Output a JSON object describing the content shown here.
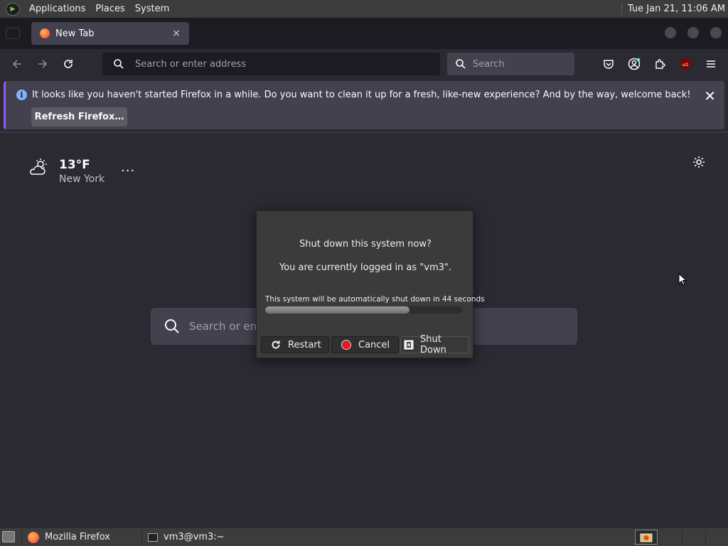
{
  "top_panel": {
    "menus": [
      "Applications",
      "Places",
      "System"
    ],
    "clock": "Tue Jan 21, 11:06 AM"
  },
  "browser": {
    "tab": {
      "title": "New Tab",
      "close": "×"
    },
    "urlbar": {
      "placeholder": "Search or enter address"
    },
    "searchbar": {
      "placeholder": "Search"
    },
    "notification": {
      "message": "It looks like you haven't started Firefox in a while. Do you want to clean it up for a fresh, like-new experience? And by the way, welcome back!",
      "button": "Refresh Firefox…",
      "close": "✕",
      "info": "i"
    }
  },
  "newtab": {
    "weather": {
      "temp": "13°F",
      "city": "New York",
      "more": "···"
    },
    "search_placeholder": "Search or ente"
  },
  "dialog": {
    "title": "Shut down this system now?",
    "subtitle": "You are currently logged in as \"vm3\".",
    "auto_text": "This system will be automatically shut down in 44 seconds",
    "progress": 0.73,
    "buttons": {
      "restart": "Restart",
      "cancel": "Cancel",
      "shutdown": "Shut Down"
    }
  },
  "taskbar": {
    "tasks": [
      {
        "label": "Mozilla Firefox"
      },
      {
        "label": "vm3@vm3:~"
      }
    ]
  },
  "colors": {
    "accent_purple": "#8f5af5",
    "info_blue": "#80b3ff",
    "cancel_red": "#e01b24"
  }
}
